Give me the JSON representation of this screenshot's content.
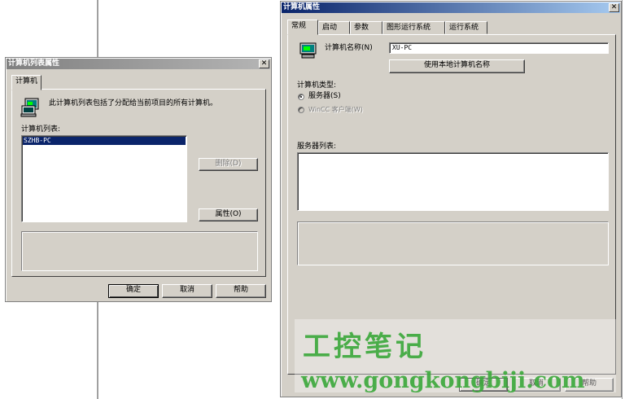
{
  "list_dialog": {
    "title": "计算机列表属性",
    "close_glyph": "✕",
    "tab_label": "计算机",
    "description": "此计算机列表包括了分配给当前项目的所有计算机。",
    "list_label": "计算机列表:",
    "list_items": [
      "SZHB-PC"
    ],
    "delete_label": "删除(D)",
    "properties_label": "属性(O)",
    "ok_label": "确定",
    "cancel_label": "取消",
    "help_label": "帮助"
  },
  "props_dialog": {
    "title": "计算机属性",
    "close_glyph": "✕",
    "tabs": [
      "常规",
      "启动",
      "参数",
      "图形运行系统",
      "运行系统"
    ],
    "computer_name_label": "计算机名称(N)",
    "computer_name_value": "XU-PC",
    "use_local_name_label": "使用本地计算机名称",
    "computer_type_label": "计算机类型:",
    "server_option_label": "服务器(S)",
    "client_option_label": "WinCC 客户端(W)",
    "server_list_label": "服务器列表:",
    "ok_label": "确定",
    "cancel_label": "取消",
    "help_label": "帮助"
  },
  "watermark": {
    "line1": "工控笔记",
    "line2": "www.gongkongbiji.com"
  },
  "colors": {
    "dialog_face": "#d4d0c8",
    "active_title": "#0a246a",
    "inactive_title": "#808080",
    "selection": "#0a246a",
    "watermark": "#3aa83a"
  },
  "icons": {
    "computer": "computer-icon",
    "close": "close-icon"
  }
}
